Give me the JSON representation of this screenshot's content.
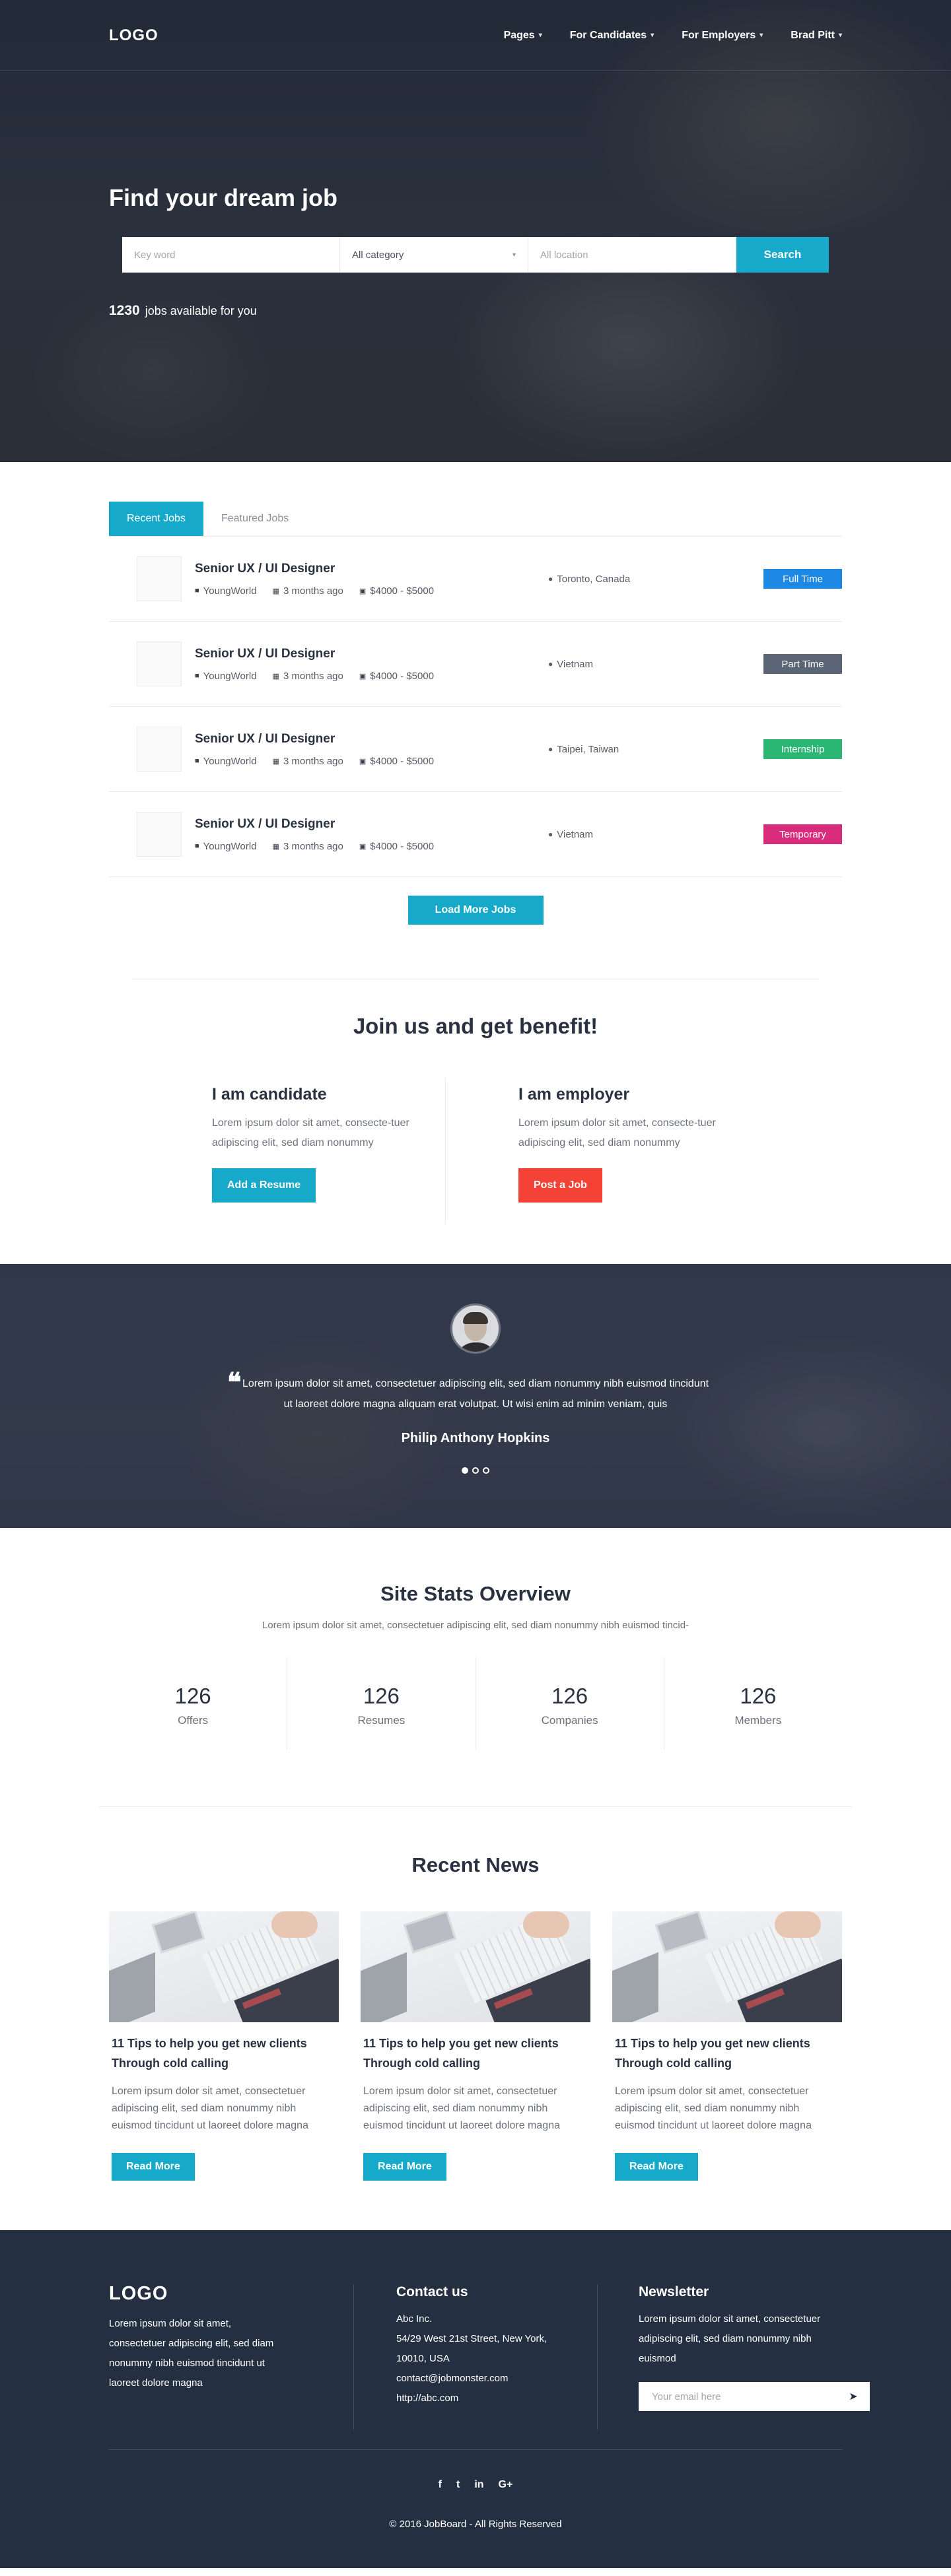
{
  "header": {
    "logo": "LOGO",
    "nav": [
      {
        "label": "Pages"
      },
      {
        "label": "For Candidates"
      },
      {
        "label": "For Employers"
      },
      {
        "label": "Brad Pitt"
      }
    ]
  },
  "hero": {
    "title": "Find your dream job",
    "search": {
      "keyword_placeholder": "Key word",
      "category_value": "All category",
      "location_placeholder": "All location",
      "button_label": "Search"
    },
    "jobs_count": "1230",
    "jobs_count_label": "jobs available for you"
  },
  "jobs": {
    "tabs": [
      {
        "label": "Recent Jobs",
        "active": true
      },
      {
        "label": "Featured Jobs",
        "active": false
      }
    ],
    "items": [
      {
        "title": "Senior UX / UI Designer",
        "company": "YoungWorld",
        "posted": "3 months ago",
        "salary": "$4000 - $5000",
        "location": "Toronto, Canada",
        "type": "Full Time",
        "type_color": "#1e88e5"
      },
      {
        "title": "Senior UX / UI Designer",
        "company": "YoungWorld",
        "posted": "3 months ago",
        "salary": "$4000 - $5000",
        "location": "Vietnam",
        "type": "Part Time",
        "type_color": "#5c6575"
      },
      {
        "title": "Senior UX / UI Designer",
        "company": "YoungWorld",
        "posted": "3 months ago",
        "salary": "$4000 - $5000",
        "location": "Taipei, Taiwan",
        "type": "Internship",
        "type_color": "#2bb673"
      },
      {
        "title": "Senior UX / UI Designer",
        "company": "YoungWorld",
        "posted": "3 months ago",
        "salary": "$4000 - $5000",
        "location": "Vietnam",
        "type": "Temporary",
        "type_color": "#d92c7d"
      }
    ],
    "load_more_label": "Load More Jobs"
  },
  "benefit": {
    "title": "Join us and get benefit!",
    "candidate": {
      "title": "I am candidate",
      "text": "Lorem ipsum dolor sit amet, consecte-tuer adipiscing elit, sed diam nonummy",
      "button": "Add a Resume"
    },
    "employer": {
      "title": "I am employer",
      "text": "Lorem ipsum dolor sit amet, consecte-tuer adipiscing elit, sed diam nonummy",
      "button": "Post a Job"
    }
  },
  "testimonial": {
    "quote": "Lorem ipsum dolor sit amet, consectetuer adipiscing elit, sed diam nonummy nibh euismod tincidunt ut laoreet dolore magna aliquam erat volutpat. Ut wisi enim ad minim veniam, quis",
    "name": "Philip Anthony Hopkins",
    "slides": 3,
    "active_slide": 1
  },
  "stats": {
    "title": "Site Stats Overview",
    "subtitle": "Lorem ipsum dolor sit amet, consectetuer adipiscing elit, sed diam nonummy nibh euismod tincid-",
    "items": [
      {
        "value": "126",
        "label": "Offers"
      },
      {
        "value": "126",
        "label": "Resumes"
      },
      {
        "value": "126",
        "label": "Companies"
      },
      {
        "value": "126",
        "label": "Members"
      }
    ]
  },
  "news": {
    "title": "Recent News",
    "items": [
      {
        "title": "11 Tips to help you get new clients Through cold calling",
        "text": "Lorem ipsum dolor sit amet, consectetuer adipiscing elit, sed diam nonummy nibh euismod tincidunt ut laoreet dolore magna",
        "button": "Read More"
      },
      {
        "title": "11 Tips to help you get new clients Through cold calling",
        "text": "Lorem ipsum dolor sit amet, consectetuer adipiscing elit, sed diam nonummy nibh euismod tincidunt ut laoreet dolore magna",
        "button": "Read More"
      },
      {
        "title": "11 Tips to help you get new clients Through cold calling",
        "text": "Lorem ipsum dolor sit amet, consectetuer adipiscing elit, sed diam nonummy nibh euismod tincidunt ut laoreet dolore magna",
        "button": "Read More"
      }
    ]
  },
  "footer": {
    "logo": "LOGO",
    "about": "Lorem ipsum dolor sit amet, consectetuer adipiscing elit, sed diam nonummy nibh euismod tincidunt ut laoreet dolore magna",
    "contact_title": "Contact us",
    "contact_lines": [
      "Abc Inc.",
      "54/29 West 21st Street, New York,",
      "10010, USA",
      "contact@jobmonster.com",
      "http://abc.com"
    ],
    "newsletter_title": "Newsletter",
    "newsletter_text": "Lorem ipsum dolor sit amet, consectetuer adipiscing elit, sed diam nonummy nibh euismod",
    "newsletter_placeholder": "Your email here",
    "socials": [
      "f",
      "t",
      "in",
      "G+"
    ],
    "copyright": "© 2016 JobBoard - All Rights Reserved"
  }
}
